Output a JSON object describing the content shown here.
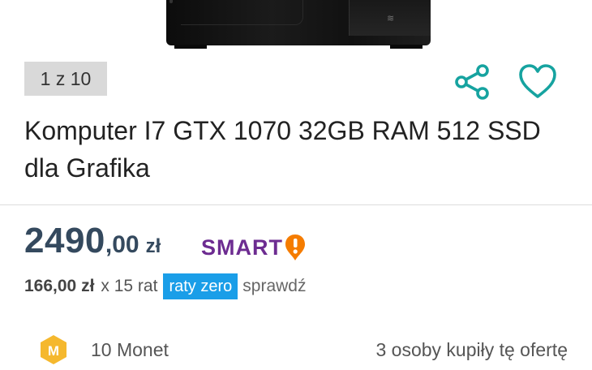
{
  "gallery": {
    "counter": "1 z 10"
  },
  "icons": {
    "share": "share-icon",
    "favorite": "heart-icon",
    "coin": "coin-icon",
    "smart_logo": "smart-logo-icon"
  },
  "product": {
    "title": "Komputer I7 GTX 1070 32GB RAM 512 SSD dla Grafika"
  },
  "price": {
    "integer": "2490",
    "decimal": ",00",
    "currency": "zł",
    "smart_label": "SMART"
  },
  "installments": {
    "amount": "166,00 zł",
    "count": "x 15 rat",
    "badge": "raty zero",
    "link": "sprawdź"
  },
  "coins": {
    "icon_letter": "M",
    "label": "10 Monet"
  },
  "buyers": {
    "text": "3 osoby kupiły tę ofertę"
  },
  "colors": {
    "accent_teal": "#16a3a0",
    "price": "#34495e",
    "smart_purple": "#6d2c91",
    "smart_orange": "#f57c00",
    "raty_blue": "#1a9ee8",
    "coin_yellow": "#f5b82e"
  }
}
